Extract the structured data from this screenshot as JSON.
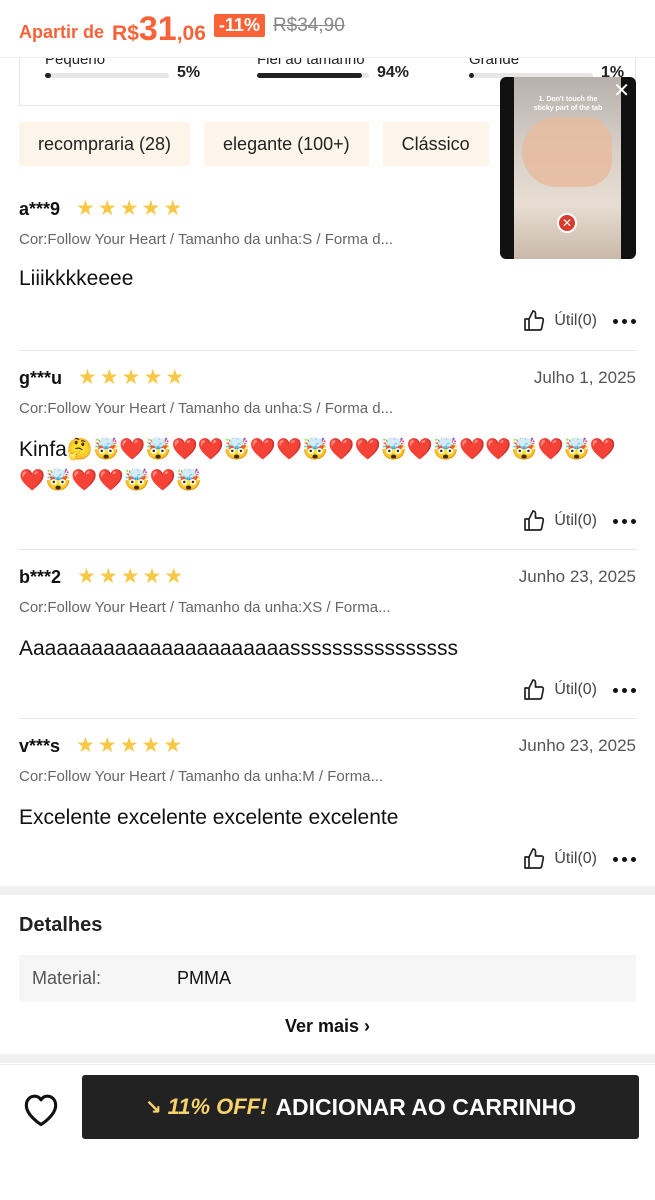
{
  "price_bar": {
    "prefix": "Apartir de",
    "currency": "R$",
    "integer": "31",
    "decimal": ",06",
    "discount": "-11%",
    "original_price": "R$34,90"
  },
  "fit": {
    "items": [
      {
        "label": "Pequeno",
        "percent_text": "5%",
        "fraction": 0.05
      },
      {
        "label": "Fiel ao tamanho",
        "percent_text": "94%",
        "fraction": 0.94
      },
      {
        "label": "Grande",
        "percent_text": "1%",
        "fraction": 0.01
      }
    ]
  },
  "tags": [
    "recompraria (28)",
    "elegante (100+)",
    "Clássico"
  ],
  "video": {
    "caption": "1. Don't touch the sticky part of the tab",
    "close_symbol": "✕"
  },
  "reviews": [
    {
      "user": "a***9",
      "rating": 5,
      "date": "",
      "attributes": "Cor:Follow Your Heart / Tamanho da unha:S / Forma d...",
      "text": "Liiikkkkeeee",
      "useful": "Útil(0)"
    },
    {
      "user": "g***u",
      "rating": 5,
      "date": "Julho 1, 2025",
      "attributes": "Cor:Follow Your Heart / Tamanho da unha:S / Forma d...",
      "text": "Kinfa🤔🤯❤️🤯❤️❤️🤯❤️❤️🤯❤️❤️🤯❤️🤯❤️❤️🤯❤️🤯❤️❤️🤯❤️❤️🤯❤️🤯",
      "useful": "Útil(0)"
    },
    {
      "user": "b***2",
      "rating": 5,
      "date": "Junho 23, 2025",
      "attributes": "Cor:Follow Your Heart / Tamanho da unha:XS / Forma...",
      "text": "Aaaaaaaaaaaaaaaaaaaaaaassssssssssssssss",
      "useful": "Útil(0)"
    },
    {
      "user": "v***s",
      "rating": 5,
      "date": "Junho 23, 2025",
      "attributes": "Cor:Follow Your Heart / Tamanho da unha:M / Forma...",
      "text": "Excelente excelente excelente excelente",
      "useful": "Útil(0)"
    }
  ],
  "details": {
    "title": "Detalhes",
    "rows": [
      {
        "key": "Material:",
        "value": "PMMA"
      }
    ],
    "see_more": "Ver mais"
  },
  "bottom_bar": {
    "promo": "11% OFF!",
    "cart_label": "ADICIONAR AO CARRINHO"
  },
  "colors": {
    "accent": "#fa6338",
    "star": "#f7c846",
    "tag_bg": "#fdf5ea",
    "cart_bg": "#222222",
    "promo": "#f8d36b"
  }
}
